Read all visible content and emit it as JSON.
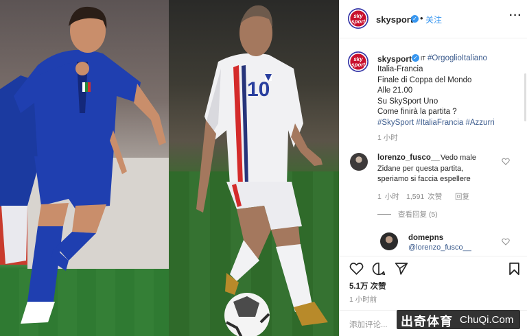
{
  "header": {
    "username": "skysport",
    "follow": "关注",
    "more": "···",
    "avatar_text": "sky sport"
  },
  "caption": {
    "username": "skysport",
    "prefix": "IT",
    "tag_line": "#OrgoglioItaliano",
    "lines": [
      "Italia-Francia",
      "Finale di Coppa del Mondo",
      "Alle 21.00",
      "Su SkySport Uno",
      "Come finirà la partita ?"
    ],
    "hashtags": "#SkySport #ItaliaFrancia #Azzurri",
    "time": "1 小时"
  },
  "comments": [
    {
      "username": "lorenzo_fusco__",
      "text_lines": [
        "Vedo male",
        "Zidane per questa partita,",
        "speriamo si faccia espellere"
      ],
      "time": "1 小时",
      "likes": "1,591 次赞",
      "reply": "回复"
    },
    {
      "username": "domepns",
      "mention": "@lorenzo_fusco__"
    }
  ],
  "view_replies": "查看回复 (5)",
  "likes_count": "5.1万 次赞",
  "post_time": "1 小时前",
  "add_comment_placeholder": "添加评论...",
  "photo": {
    "jersey_number": "10"
  },
  "watermark": {
    "cn": "出奇体育",
    "en": "ChuQi.Com"
  },
  "colors": {
    "link_blue": "#3897f0",
    "hashtag_blue": "#3a5a8c",
    "muted_gray": "#8e8e8e",
    "italy_blue": "#1f3fb0",
    "sky_red": "#c8102e"
  },
  "icons": [
    "heart-icon",
    "comment-icon",
    "share-icon",
    "bookmark-icon",
    "verified-icon",
    "more-options-icon"
  ]
}
